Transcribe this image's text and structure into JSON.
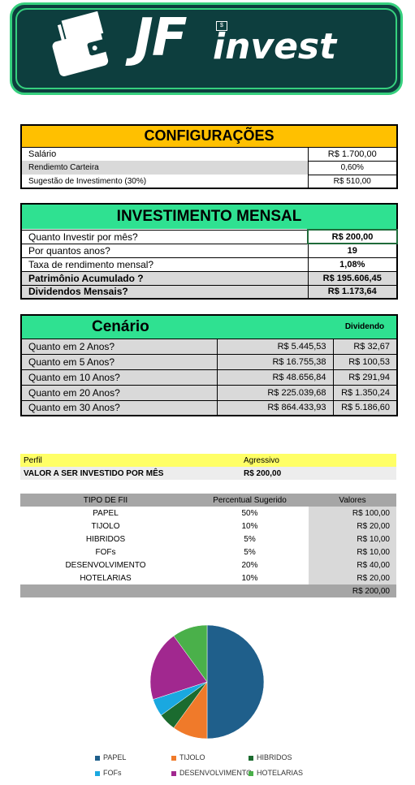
{
  "header": {
    "logo_part1": "JF",
    "logo_part2": "invest"
  },
  "config": {
    "title": "CONFIGURAÇÕES",
    "rows": [
      {
        "label": "Salário",
        "value": "R$ 1.700,00"
      },
      {
        "label": "Rendiemto Carteira",
        "value": "0,60%"
      },
      {
        "label": "Sugestão de Investimento (30%)",
        "value": "R$ 510,00"
      }
    ]
  },
  "mensal": {
    "title": "INVESTIMENTO MENSAL",
    "rows": [
      {
        "label": "Quanto Investir por mês?",
        "value": "R$ 200,00"
      },
      {
        "label": "Por quantos anos?",
        "value": "19"
      },
      {
        "label": "Taxa de rendimento mensal?",
        "value": "1,08%"
      },
      {
        "label": "Patrimônio Acumulado ?",
        "value": "R$ 195.606,45"
      },
      {
        "label": "Dividendos Mensais?",
        "value": "R$ 1.173,64"
      }
    ]
  },
  "cenario": {
    "title": "Cenário",
    "dividend_header": "Dividendo",
    "rows": [
      {
        "label": "Quanto em 2 Anos?",
        "value": "R$ 5.445,53",
        "dividend": "R$ 32,67"
      },
      {
        "label": "Quanto em 5 Anos?",
        "value": "R$ 16.755,38",
        "dividend": "R$ 100,53"
      },
      {
        "label": "Quanto em 10 Anos?",
        "value": "R$ 48.656,84",
        "dividend": "R$ 291,94"
      },
      {
        "label": "Quanto em 20 Anos?",
        "value": "R$ 225.039,68",
        "dividend": "R$ 1.350,24"
      },
      {
        "label": "Quanto em 30 Anos?",
        "value": "R$ 864.433,93",
        "dividend": "R$ 5.186,60"
      }
    ]
  },
  "perfil": {
    "label": "Perfil",
    "value": "Agressivo",
    "invest_label": "VALOR A SER INVESTIDO POR MÊS",
    "invest_value": "R$ 200,00"
  },
  "fii": {
    "headers": [
      "TIPO DE FII",
      "Percentual Sugerido",
      "Valores"
    ],
    "rows": [
      {
        "tipo": "PAPEL",
        "pct": "50%",
        "valor": "R$ 100,00"
      },
      {
        "tipo": "TIJOLO",
        "pct": "10%",
        "valor": "R$ 20,00"
      },
      {
        "tipo": "HIBRIDOS",
        "pct": "5%",
        "valor": "R$ 10,00"
      },
      {
        "tipo": "FOFs",
        "pct": "5%",
        "valor": "R$ 10,00"
      },
      {
        "tipo": "DESENVOLVIMENTO",
        "pct": "20%",
        "valor": "R$ 40,00"
      },
      {
        "tipo": "HOTELARIAS",
        "pct": "10%",
        "valor": "R$ 20,00"
      }
    ],
    "total": "R$ 200,00"
  },
  "colors": {
    "config_header": "#ffc000",
    "green_header": "#2fe191",
    "perfil_yellow": "#ffff66"
  },
  "chart_data": {
    "type": "pie",
    "categories": [
      "PAPEL",
      "TIJOLO",
      "HIBRIDOS",
      "FOFs",
      "DESENVOLVIMENTO",
      "HOTELARIAS"
    ],
    "values": [
      100,
      20,
      10,
      10,
      40,
      20
    ],
    "colors": [
      "#1f5f8b",
      "#f07a2a",
      "#1b6b2f",
      "#1aa8e0",
      "#a1288f",
      "#4ab04a"
    ],
    "legend_position": "bottom"
  }
}
